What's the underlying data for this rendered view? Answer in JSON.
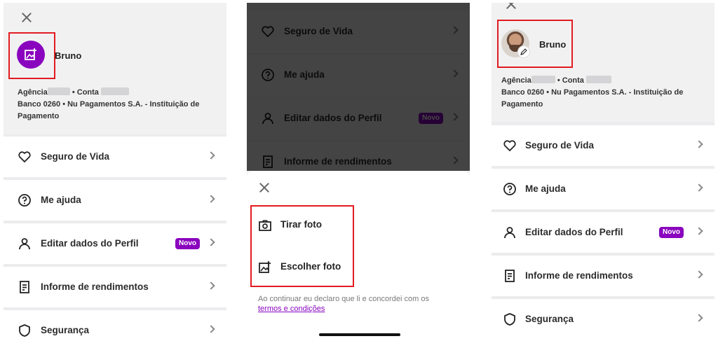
{
  "colors": {
    "accent": "#8a05be",
    "highlight": "#e21b22",
    "badge_text": "#ffffff"
  },
  "icons": {
    "close": "close-icon",
    "avatar_placeholder": "image-add-icon",
    "edit": "pencil-icon",
    "camera": "camera-icon",
    "gallery": "image-add-icon",
    "chevron": "chevron-right-icon"
  },
  "profile": {
    "name": "Bruno",
    "agency_label": "Agência",
    "account_label": "• Conta",
    "bank_line": "Banco 0260 • Nu Pagamentos S.A. - Instituição de Pagamento"
  },
  "menu": {
    "life_insurance": "Seguro de Vida",
    "help": "Me ajuda",
    "edit_profile": "Editar dados do Perfil",
    "new_badge": "Novo",
    "income_report": "Informe de rendimentos",
    "security": "Segurança"
  },
  "sheet": {
    "take_photo": "Tirar foto",
    "choose_photo": "Escolher foto",
    "disclaimer": "Ao continuar eu declaro que li e concordei com os",
    "terms_link": "termos e condições"
  }
}
